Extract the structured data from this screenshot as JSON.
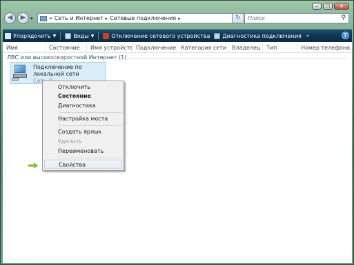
{
  "address": {
    "crumbs": [
      "Сеть и Интернет",
      "Сетевые подключения"
    ],
    "lead": "«"
  },
  "search": {
    "placeholder": "Поиск"
  },
  "toolbar": {
    "organize": "Упорядочить",
    "views": "Виды",
    "disable": "Отключение сетевого устройства",
    "diagnose": "Диагностика подключения"
  },
  "columns": [
    "Имя",
    "Состояние",
    "Имя устройства",
    "Подключение",
    "Категория сети",
    "Владелец",
    "Тип",
    "Номер телефона..."
  ],
  "group": {
    "title": "ЛВС или высокоскоростной Интернет (1)"
  },
  "item": {
    "name": "Подключение по локальной сети",
    "status": "Сеть 2"
  },
  "context_menu": {
    "items": [
      "Отключить",
      "Состояние",
      "Диагностика",
      "Настройка моста",
      "Создать ярлык",
      "Удалить",
      "Переименовать",
      "Свойства"
    ]
  },
  "colors": {
    "toolbar": "#0e3450",
    "selection": "#d9ecf9",
    "arrow": "#7ac21f"
  }
}
